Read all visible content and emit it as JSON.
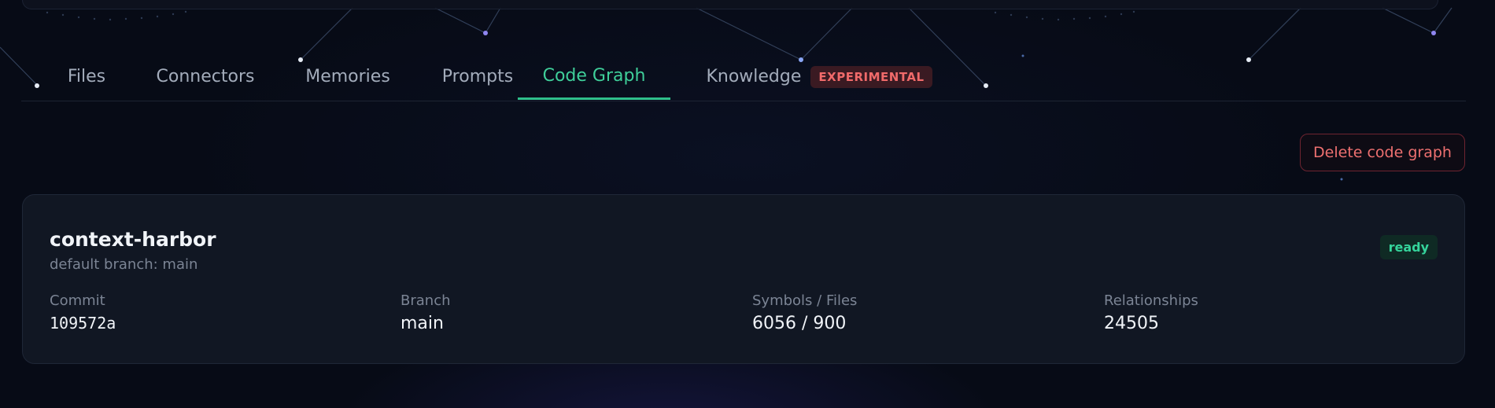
{
  "colors": {
    "background": "#070b16",
    "accent": "#3fcf9a",
    "danger": "#ee7070",
    "card": "#111723"
  },
  "tabs": [
    {
      "label": "Files"
    },
    {
      "label": "Connectors"
    },
    {
      "label": "Memories"
    },
    {
      "label": "Prompts"
    },
    {
      "label": "Code Graph",
      "active": true
    },
    {
      "label": "Knowledge",
      "badge": "EXPERIMENTAL"
    }
  ],
  "actions": {
    "delete_label": "Delete code graph"
  },
  "repo": {
    "name": "context-harbor",
    "subtitle": "default branch: main",
    "status": "ready",
    "stats": [
      {
        "label": "Commit",
        "value": "109572a"
      },
      {
        "label": "Branch",
        "value": "main"
      },
      {
        "label": "Symbols / Files",
        "value": "6056 / 900"
      },
      {
        "label": "Relationships",
        "value": "24505"
      }
    ]
  }
}
